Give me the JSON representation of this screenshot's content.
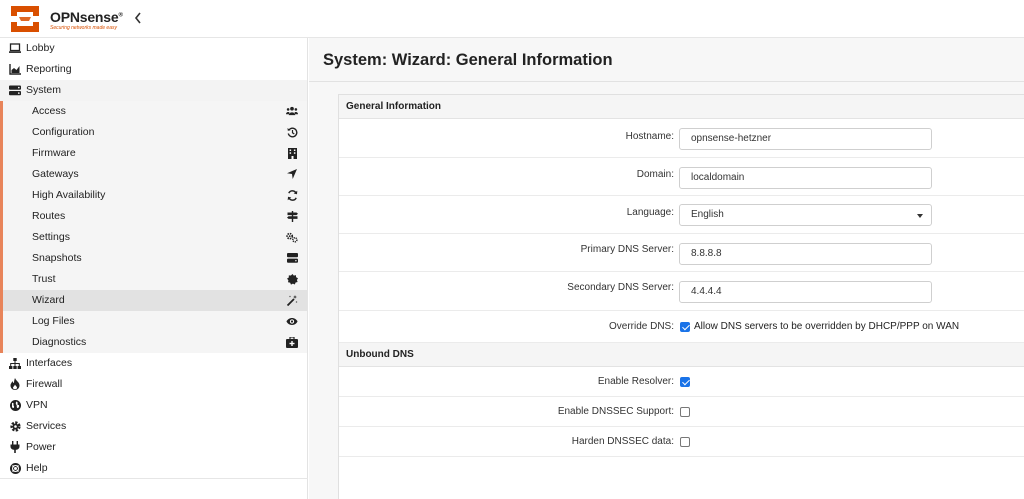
{
  "brand": {
    "name": "OPNsense",
    "reg": "®",
    "tagline": "Securing networks made easy",
    "accent": "#d94f00"
  },
  "sidebar": {
    "top_items": [
      {
        "label": "Lobby",
        "icon": "laptop-icon"
      },
      {
        "label": "Reporting",
        "icon": "area-chart-icon"
      },
      {
        "label": "System",
        "icon": "server-icon"
      }
    ],
    "system_items": [
      {
        "label": "Access",
        "icon": "users-icon"
      },
      {
        "label": "Configuration",
        "icon": "history-icon"
      },
      {
        "label": "Firmware",
        "icon": "building-icon"
      },
      {
        "label": "Gateways",
        "icon": "location-arrow-icon"
      },
      {
        "label": "High Availability",
        "icon": "refresh-icon"
      },
      {
        "label": "Routes",
        "icon": "map-signs-icon"
      },
      {
        "label": "Settings",
        "icon": "cogs-icon"
      },
      {
        "label": "Snapshots",
        "icon": "hdd-icon"
      },
      {
        "label": "Trust",
        "icon": "certificate-icon"
      },
      {
        "label": "Wizard",
        "icon": "magic-icon"
      },
      {
        "label": "Log Files",
        "icon": "eye-icon"
      },
      {
        "label": "Diagnostics",
        "icon": "medkit-icon"
      }
    ],
    "bottom_items": [
      {
        "label": "Interfaces",
        "icon": "sitemap-icon"
      },
      {
        "label": "Firewall",
        "icon": "fire-icon"
      },
      {
        "label": "VPN",
        "icon": "globe-icon"
      },
      {
        "label": "Services",
        "icon": "cog-icon"
      },
      {
        "label": "Power",
        "icon": "plug-icon"
      },
      {
        "label": "Help",
        "icon": "life-ring-icon"
      }
    ],
    "active": "Wizard"
  },
  "page": {
    "title": "System: Wizard: General Information"
  },
  "general": {
    "heading": "General Information",
    "hostname_label": "Hostname:",
    "hostname_value": "opnsense-hetzner",
    "domain_label": "Domain:",
    "domain_value": "localdomain",
    "language_label": "Language:",
    "language_value": "English",
    "dns1_label": "Primary DNS Server:",
    "dns1_value": "8.8.8.8",
    "dns2_label": "Secondary DNS Server:",
    "dns2_value": "4.4.4.4",
    "override_label": "Override DNS:",
    "override_text": "Allow DNS servers to be overridden by DHCP/PPP on WAN",
    "override_checked": true
  },
  "unbound": {
    "heading": "Unbound DNS",
    "resolver_label": "Enable Resolver:",
    "resolver_checked": true,
    "dnssec_label": "Enable DNSSEC Support:",
    "dnssec_checked": false,
    "harden_label": "Harden DNSSEC data:",
    "harden_checked": false
  }
}
